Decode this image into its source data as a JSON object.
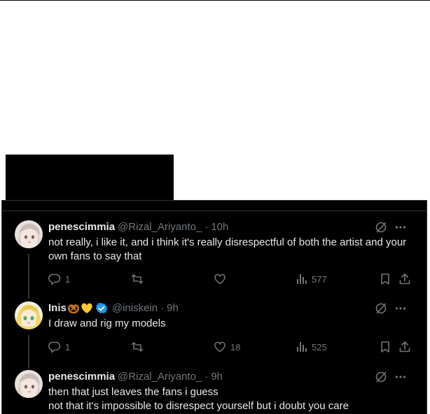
{
  "tweets": [
    {
      "name": "penescimmia",
      "handle": "@Rizal_Ariyanto_",
      "separator": "·",
      "time": "10h",
      "text": "not really, i like it, and i think it's really disrespectful of both the artist and your own fans to say that",
      "replies": "1",
      "reposts": "",
      "likes": "",
      "views": "577"
    },
    {
      "name": "Inis",
      "handle": "@iniskein",
      "separator": "·",
      "time": "9h",
      "text": "I draw and rig my models",
      "replies": "1",
      "reposts": "",
      "likes": "18",
      "views": "525"
    },
    {
      "name": "penescimmia",
      "handle": "@Rizal_Ariyanto_",
      "separator": "·",
      "time": "9h",
      "text": "then that just leaves the fans i guess\nnot that it's impossible to disrespect yourself but i doubt you care"
    }
  ],
  "colors": {
    "background": "#000000",
    "text_primary": "#e7e9ea",
    "text_secondary": "#71767b",
    "verified": "#1d9bf0",
    "border": "#2f3336"
  },
  "icons": [
    "grok-icon",
    "more-icon",
    "reply-icon",
    "repost-icon",
    "like-icon",
    "views-icon",
    "bookmark-icon",
    "share-icon",
    "verified-badge-icon",
    "pretzel-emoji",
    "yellow-heart-emoji"
  ]
}
